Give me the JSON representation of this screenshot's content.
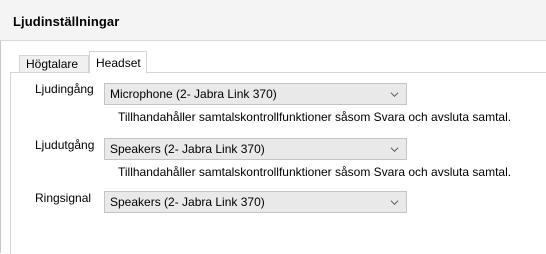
{
  "window": {
    "title": "Ljudinställningar"
  },
  "tabs": [
    {
      "label": "Högtalare",
      "active": false
    },
    {
      "label": "Headset",
      "active": true
    }
  ],
  "fields": [
    {
      "label": "Ljudingång",
      "value": "Microphone (2- Jabra Link 370)",
      "hint": "Tillhandahåller samtalskontrollfunktioner såsom Svara och avsluta samtal."
    },
    {
      "label": "Ljudutgång",
      "value": "Speakers (2- Jabra Link 370)",
      "hint": "Tillhandahåller samtalskontrollfunktioner såsom Svara och avsluta samtal."
    },
    {
      "label": "Ringsignal",
      "value": "Speakers (2- Jabra Link 370)"
    }
  ],
  "icons": {
    "dropdown": "chevron-down-icon"
  },
  "colors": {
    "dropdown_bg": "#e9e9e9",
    "header_bg": "#f4f4f4"
  }
}
